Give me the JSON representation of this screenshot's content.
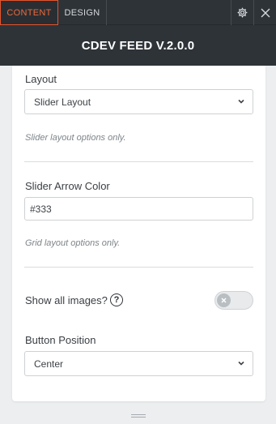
{
  "tabs": [
    {
      "label": "Content",
      "active": true
    },
    {
      "label": "Design",
      "active": false
    }
  ],
  "toolbar_icons": [
    "gear-icon",
    "close-icon"
  ],
  "header": {
    "title": "CDEV FEED V.2.0.0"
  },
  "form": {
    "layout": {
      "label": "Layout",
      "value": "Slider Layout",
      "hint": "Slider layout options only."
    },
    "arrow_color": {
      "label": "Slider Arrow Color",
      "value": "#333",
      "hint": "Grid layout options only."
    },
    "show_all_images": {
      "label": "Show all images?",
      "help_glyph": "?",
      "enabled": false
    },
    "button_position": {
      "label": "Button Position",
      "value": "Center"
    }
  },
  "colors": {
    "accent": "#e4542c",
    "toolbar_bg": "#2e3338",
    "panel_bg": "#ffffff",
    "page_bg": "#eceeef"
  }
}
